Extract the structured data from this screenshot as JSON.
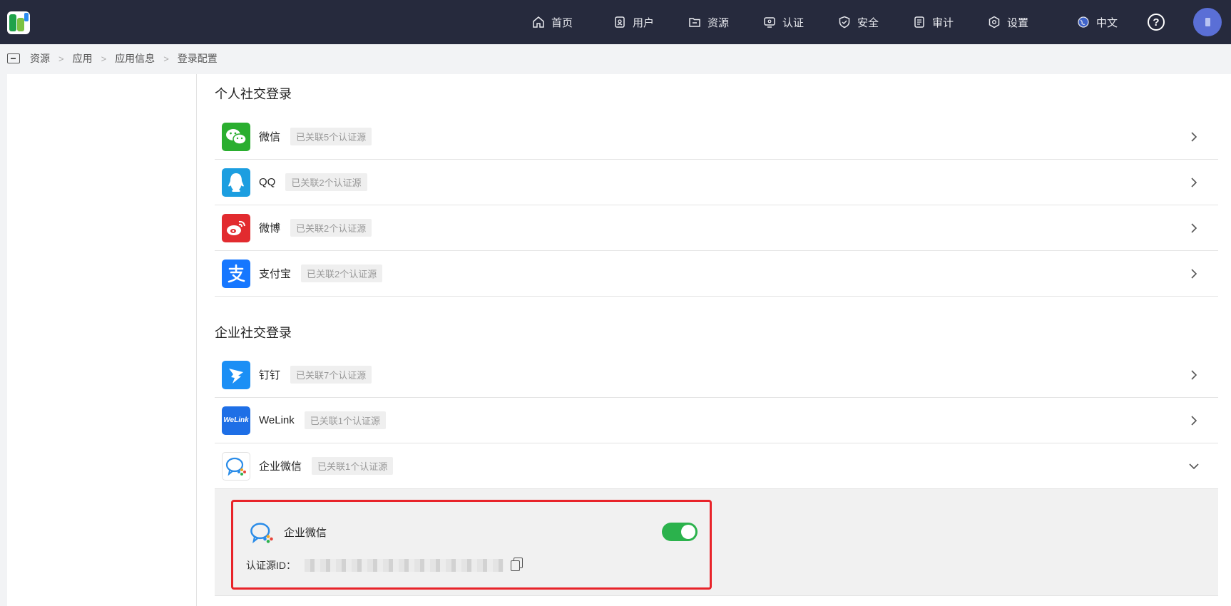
{
  "nav": {
    "items": [
      {
        "label": "首页",
        "icon": "home-icon"
      },
      {
        "label": "用户",
        "icon": "user-icon"
      },
      {
        "label": "资源",
        "icon": "resource-icon"
      },
      {
        "label": "认证",
        "icon": "monitor-icon"
      },
      {
        "label": "安全",
        "icon": "shield-icon"
      },
      {
        "label": "审计",
        "icon": "audit-icon"
      },
      {
        "label": "设置",
        "icon": "settings-icon"
      }
    ],
    "language": "中文",
    "help": "?"
  },
  "breadcrumb": [
    "资源",
    "应用",
    "应用信息",
    "登录配置"
  ],
  "personal": {
    "title": "个人社交登录",
    "items": [
      {
        "name": "微信",
        "badge": "已关联5个认证源",
        "color": "#2aae2f",
        "icon": "wechat-icon"
      },
      {
        "name": "QQ",
        "badge": "已关联2个认证源",
        "color": "#1c9ee0",
        "icon": "qq-icon"
      },
      {
        "name": "微博",
        "badge": "已关联2个认证源",
        "color": "#e22b2f",
        "icon": "weibo-icon"
      },
      {
        "name": "支付宝",
        "badge": "已关联2个认证源",
        "color": "#1677ff",
        "icon": "alipay-icon"
      }
    ]
  },
  "enterprise": {
    "title": "企业社交登录",
    "items": [
      {
        "name": "钉钉",
        "badge": "已关联7个认证源",
        "color": "#1b8ff5",
        "icon": "dingtalk-icon"
      },
      {
        "name": "WeLink",
        "badge": "已关联1个认证源",
        "color": "#1e6fe6",
        "icon": "welink-icon",
        "icon_text": "WeLink"
      },
      {
        "name": "企业微信",
        "badge": "已关联1个认证源",
        "color": "#ffffff",
        "icon": "wecom-icon"
      }
    ]
  },
  "source_card": {
    "name": "企业微信",
    "enabled": true,
    "id_label": "认证源ID：",
    "id_value": "2"
  },
  "colors": {
    "topbar": "#262a3d",
    "accent_green": "#2bb24c",
    "highlight_border": "#e8232a"
  }
}
